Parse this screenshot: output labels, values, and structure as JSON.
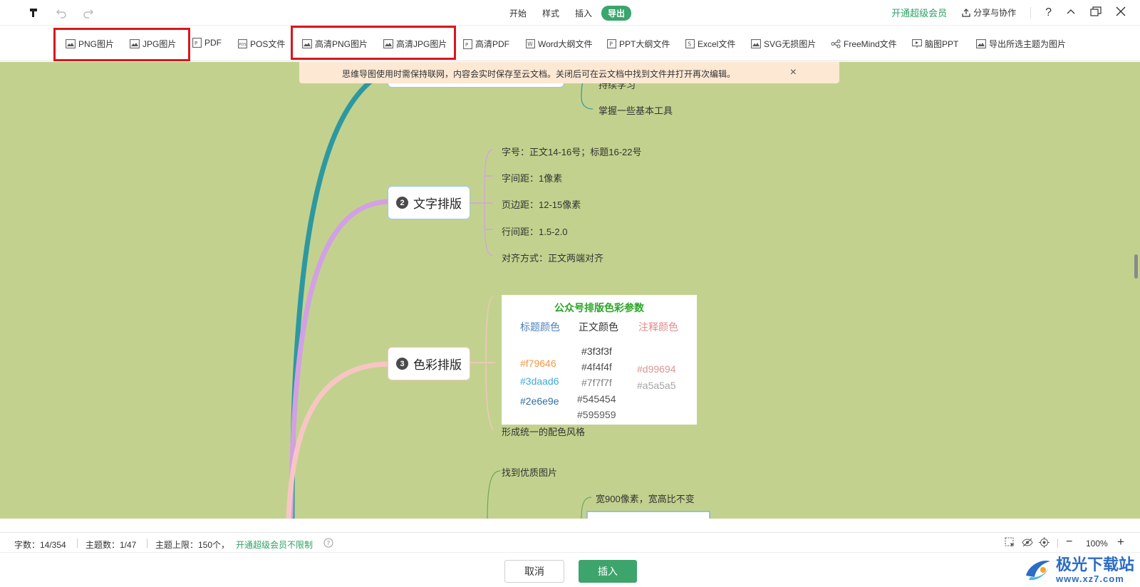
{
  "topbar": {
    "tabs": [
      {
        "label": "开始"
      },
      {
        "label": "样式"
      },
      {
        "label": "插入"
      },
      {
        "label": "导出",
        "active": true
      }
    ],
    "vip_label": "开通超级会员",
    "share_label": "分享与协作"
  },
  "export_toolbar": {
    "items": [
      {
        "label": "PNG图片",
        "icon": "image-icon"
      },
      {
        "label": "JPG图片",
        "icon": "image-icon"
      },
      {
        "label": "PDF",
        "icon": "pdf-icon"
      },
      {
        "label": "POS文件",
        "icon": "pos-icon"
      },
      {
        "label": "高清PNG图片",
        "icon": "hd-image-icon"
      },
      {
        "label": "高清JPG图片",
        "icon": "hd-image-icon"
      },
      {
        "label": "高清PDF",
        "icon": "hd-pdf-icon"
      },
      {
        "label": "Word大纲文件",
        "icon": "word-icon"
      },
      {
        "label": "PPT大纲文件",
        "icon": "ppt-icon"
      },
      {
        "label": "Excel文件",
        "icon": "excel-icon"
      },
      {
        "label": "SVG无损图片",
        "icon": "svg-icon"
      },
      {
        "label": "FreeMind文件",
        "icon": "freemind-icon"
      },
      {
        "label": "脑图PPT",
        "icon": "mindmap-ppt-icon"
      },
      {
        "label": "导出所选主题为图片",
        "icon": "export-selected-icon"
      }
    ]
  },
  "notice": {
    "text": "思维导图使用时需保持联网，内容会实时保存至云文档。关闭后可在云文档中找到文件并打开再次编辑。"
  },
  "mindmap": {
    "top_leaves": [
      "持续学习",
      "掌握一些基本工具"
    ],
    "branch2": {
      "number": "2",
      "title": "文字排版",
      "leaves": [
        "字号：正文14-16号；标题16-22号",
        "字间距：1像素",
        "页边距：12-15像素",
        "行间距：1.5-2.0",
        "对齐方式：正文两端对齐"
      ]
    },
    "branch3": {
      "number": "3",
      "title": "色彩排版",
      "color_card": {
        "title": "公众号排版色彩参数",
        "headers": [
          "标题颜色",
          "正文颜色",
          "注释颜色"
        ],
        "title_colors": [
          "#f79646",
          "#3daad6",
          "#2e6e9e"
        ],
        "body_colors": [
          "#3f3f3f",
          "#4f4f4f",
          "#7f7f7f",
          "#545454",
          "#595959"
        ],
        "note_colors": [
          "#d99694",
          "#a5a5a5"
        ]
      },
      "leaf": "形成统一的配色风格"
    },
    "branch4": {
      "leaves": [
        "找到优质图片",
        "宽900像素，宽高比不变"
      ]
    }
  },
  "colors": {
    "canvas_bg": "#c2d28e",
    "branch1_line": "#2e98a0",
    "branch2_line": "#d3a0e3",
    "branch3_line": "#f7c6c3",
    "accent_green": "#3aa56c",
    "highlight_red": "#d9171b"
  },
  "statusbar": {
    "word_count": "字数：14/354",
    "topic_count": "主题数：1/47",
    "topic_limit": "主题上限：150个，",
    "vip_link": "开通超级会员不限制",
    "zoom": "100%"
  },
  "footer": {
    "cancel_label": "取消",
    "insert_label": "插入"
  },
  "watermark": {
    "name": "极光下载站",
    "url": "www.xz7.com"
  }
}
